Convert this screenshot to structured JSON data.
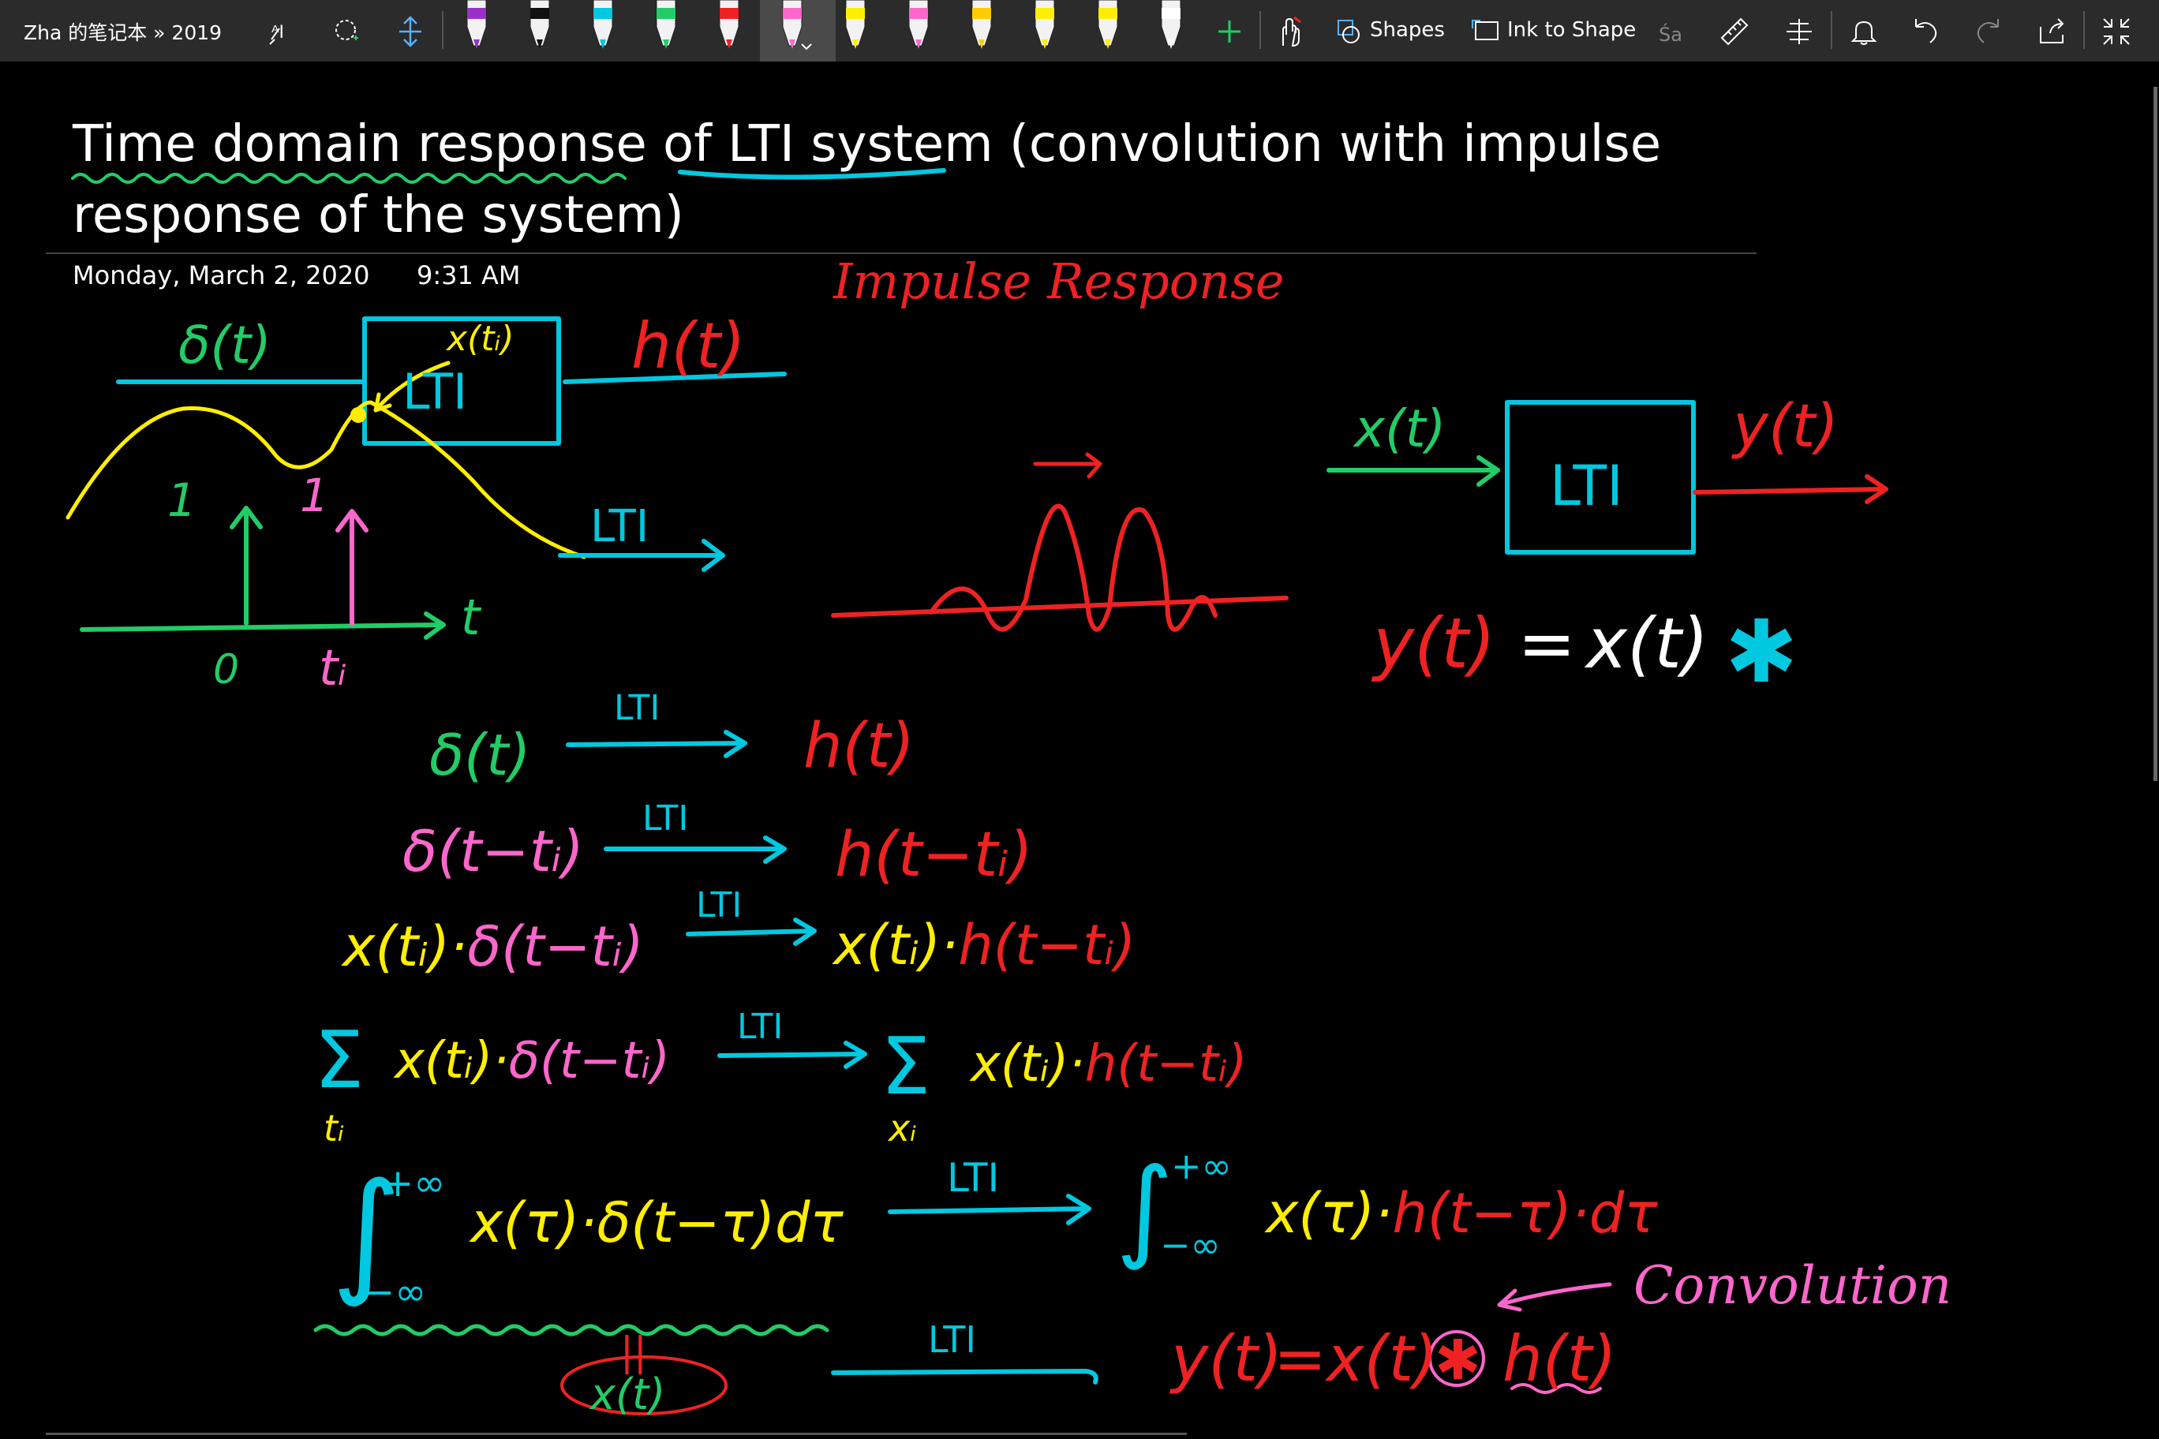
{
  "toolbar": {
    "notebook_title": "Zha 的笔记本 » 2019",
    "shapes_label": "Shapes",
    "ink_to_shape_label": "Ink to Shape",
    "pen_colors": [
      "#9b30c8",
      "#111111",
      "#00c8e0",
      "#22cc66",
      "#ee2222",
      "#ff66cc",
      "#ffee00",
      "#ff66cc",
      "#ffcc00",
      "#ffee00",
      "#ffee00",
      "#ffffff"
    ]
  },
  "page": {
    "title_line1": "Time domain response of LTI system (convolution with impulse",
    "title_line2": "response of the system)",
    "date": "Monday, March 2, 2020",
    "time": "9:31 AM"
  },
  "ink": {
    "impulse_response_heading": "Impulse Response",
    "delta_t": "δ(t)",
    "h_t": "h(t)",
    "lti": "LTI",
    "x_ti": "x(tᵢ)",
    "one": "1",
    "t": "t",
    "zero": "0",
    "t_i": "tᵢ",
    "x_t": "x(t)",
    "y_t": "y(t)",
    "y_eq": "y(t) = x(t)",
    "star": "✱",
    "r1_left": "δ(t)",
    "r1_right": "h(t)",
    "r2_left": "δ(t−tᵢ)",
    "r2_right": "h(t−tᵢ)",
    "r3_left_a": "x(tᵢ)·",
    "r3_left_b": "δ(t−tᵢ)",
    "r3_right_a": "x(tᵢ)·",
    "r3_right_b": "h(t−tᵢ)",
    "r4_sum": "Σ",
    "r4_sub_left": "tᵢ",
    "r4_left_a": "x(tᵢ)·",
    "r4_left_b": "δ(t−tᵢ)",
    "r4_sub_right": "xᵢ",
    "r4_right_a": "x(tᵢ)·",
    "r4_right_b": "h(t−tᵢ)",
    "integral": "∫",
    "upper_limit": "+∞",
    "lower_limit": "−∞",
    "r5_left": "x(τ)·δ(t−τ)dτ",
    "r5_right_a": "x(τ)·",
    "r5_right_b": "h(t−τ)·dτ",
    "equals_bar": "||",
    "r6_x": "x(t)",
    "convolution": "Convolution",
    "r6_y": "y(t)",
    "r6_eq": "=x(t)",
    "r6_h": "h(t)"
  }
}
